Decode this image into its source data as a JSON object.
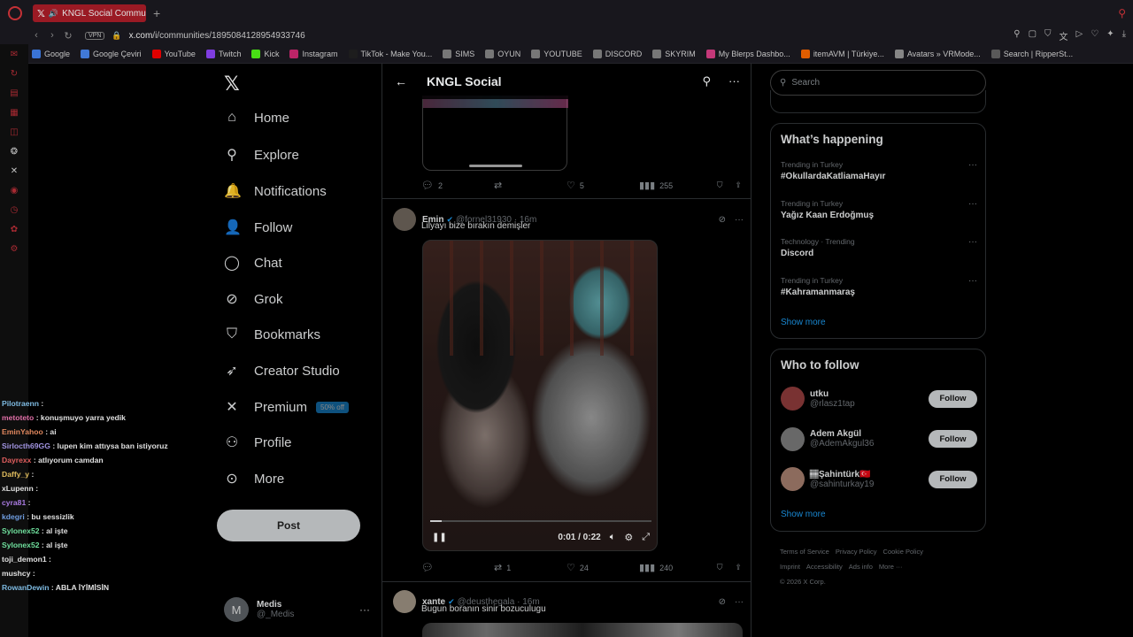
{
  "browser": {
    "tab_title": "KNGL Social Communi",
    "new_tab": "+",
    "url_host": "x.com",
    "url_path": "/i/communities/1895084128954933746",
    "vpn": "VPN",
    "bookmarks": [
      {
        "label": "Google",
        "color": "#4285f4"
      },
      {
        "label": "Google Çeviri",
        "color": "#4a8af4"
      },
      {
        "label": "YouTube",
        "color": "#ff0000"
      },
      {
        "label": "Twitch",
        "color": "#9146ff"
      },
      {
        "label": "Kick",
        "color": "#53fc18"
      },
      {
        "label": "Instagram",
        "color": "#d62976"
      },
      {
        "label": "TikTok - Make You...",
        "color": "#222222"
      },
      {
        "label": "SIMS",
        "color": "#888888"
      },
      {
        "label": "OYUN",
        "color": "#888888"
      },
      {
        "label": "YOUTUBE",
        "color": "#888888"
      },
      {
        "label": "DISCORD",
        "color": "#888888"
      },
      {
        "label": "SKYRIM",
        "color": "#888888"
      },
      {
        "label": "My Blerps Dashbo...",
        "color": "#e0408a"
      },
      {
        "label": "itemAVM | Türkiye...",
        "color": "#ff6a00"
      },
      {
        "label": "Avatars » VRMode...",
        "color": "#999999"
      },
      {
        "label": "Search | RipperSt...",
        "color": "#666666"
      }
    ]
  },
  "chat": [
    {
      "user": "Pilotraenn",
      "msg": ":",
      "color": "#8fd3ff"
    },
    {
      "user": "metoteto",
      "msg": ": konuşmuyo yarra yedik",
      "color": "#ff7fbf"
    },
    {
      "user": "EminYahoo",
      "msg": ": ai",
      "color": "#ff9a6b"
    },
    {
      "user": "Sirlocth69GG",
      "msg": ": lupen kim attıysa ban istiyoruz",
      "color": "#b7a8ff"
    },
    {
      "user": "Dayrexx",
      "msg": ": atlıyorum camdan",
      "color": "#ff6b6b"
    },
    {
      "user": "Daffy_y",
      "msg": ":",
      "color": "#ffd66b"
    },
    {
      "user": "xLupenn",
      "msg": ":",
      "color": "#ffffff"
    },
    {
      "user": "cyra81",
      "msg": ":",
      "color": "#c08bff"
    },
    {
      "user": "kdegri",
      "msg": ": bu sessizlik",
      "color": "#7fb3ff"
    },
    {
      "user": "Sylonex52",
      "msg": ": al işte",
      "color": "#7fffb3"
    },
    {
      "user": "Sylonex52",
      "msg": ": al işte",
      "color": "#7fffb3"
    },
    {
      "user": "toji_demon1",
      "msg": ":",
      "color": "#ffffff"
    },
    {
      "user": "mushcy",
      "msg": ":",
      "color": "#ffffff"
    },
    {
      "user": "RowanDewin",
      "msg": ": ABLA İYİMİSİN",
      "color": "#8fd3ff"
    }
  ],
  "nav": {
    "items": [
      {
        "label": "Home",
        "icon": "home-icon",
        "glyph": "⌂"
      },
      {
        "label": "Explore",
        "icon": "search-icon",
        "glyph": "⚲"
      },
      {
        "label": "Notifications",
        "icon": "bell-icon",
        "glyph": "🔔"
      },
      {
        "label": "Follow",
        "icon": "person-plus-icon",
        "glyph": "👤"
      },
      {
        "label": "Chat",
        "icon": "chat-icon",
        "glyph": "◯"
      },
      {
        "label": "Grok",
        "icon": "grok-icon",
        "glyph": "⊘"
      },
      {
        "label": "Bookmarks",
        "icon": "bookmark-icon",
        "glyph": "⛉"
      },
      {
        "label": "Creator Studio",
        "icon": "rocket-icon",
        "glyph": "➶"
      },
      {
        "label": "Premium",
        "icon": "x-logo-icon",
        "glyph": "✕"
      },
      {
        "label": "Profile",
        "icon": "profile-icon",
        "glyph": "⚇"
      },
      {
        "label": "More",
        "icon": "more-circle-icon",
        "glyph": "⊙"
      }
    ],
    "premium_badge": "50% off",
    "post_label": "Post",
    "account_initial": "M",
    "account_name": "Medis",
    "account_handle": "@_Medis"
  },
  "main": {
    "title": "KNGL Social",
    "prev_actions": {
      "replies": "2",
      "retweets": "",
      "likes": "5",
      "views": "255"
    },
    "tweet": {
      "name": "Emin",
      "handle": "@fornel31930",
      "time": "16m",
      "text": "Lilyayı bize bırakın demişler",
      "video_time": "0:01 / 0:22",
      "video_progress": 0.05,
      "actions": {
        "replies": "",
        "retweets": "1",
        "likes": "24",
        "views": "240"
      }
    },
    "next_tweet": {
      "name": "xante",
      "handle": "@deusthegala",
      "time": "16m",
      "text": "Bugun boranın sinir bozuculugu"
    }
  },
  "right": {
    "search_placeholder": "Search",
    "whats_happening_title": "What’s happening",
    "trends": [
      {
        "category": "Trending in Turkey",
        "name": "#OkullardaKatliamaHayır"
      },
      {
        "category": "Trending in Turkey",
        "name": "Yağız Kaan Erdoğmuş"
      },
      {
        "category": "Technology · Trending",
        "name": "Discord"
      },
      {
        "category": "Trending in Turkey",
        "name": "#Kahramanmaraş"
      }
    ],
    "show_more": "Show more",
    "who_to_follow_title": "Who to follow",
    "follow_suggestions": [
      {
        "name": "utku",
        "handle": "@rlasz1tap",
        "avatar_color": "#8a3a3a"
      },
      {
        "name": "Adem Akgül",
        "handle": "@AdemAkgul36",
        "avatar_color": "#777777"
      },
      {
        "name": "🏽Şahintürk🇹🇷",
        "handle": "@sahinturkay19",
        "avatar_color": "#a07a6a"
      }
    ],
    "follow_label": "Follow",
    "footer": [
      "Terms of Service",
      "Privacy Policy",
      "Cookie Policy",
      "Imprint",
      "Accessibility",
      "Ads info",
      "More ···",
      "© 2026 X Corp."
    ]
  }
}
